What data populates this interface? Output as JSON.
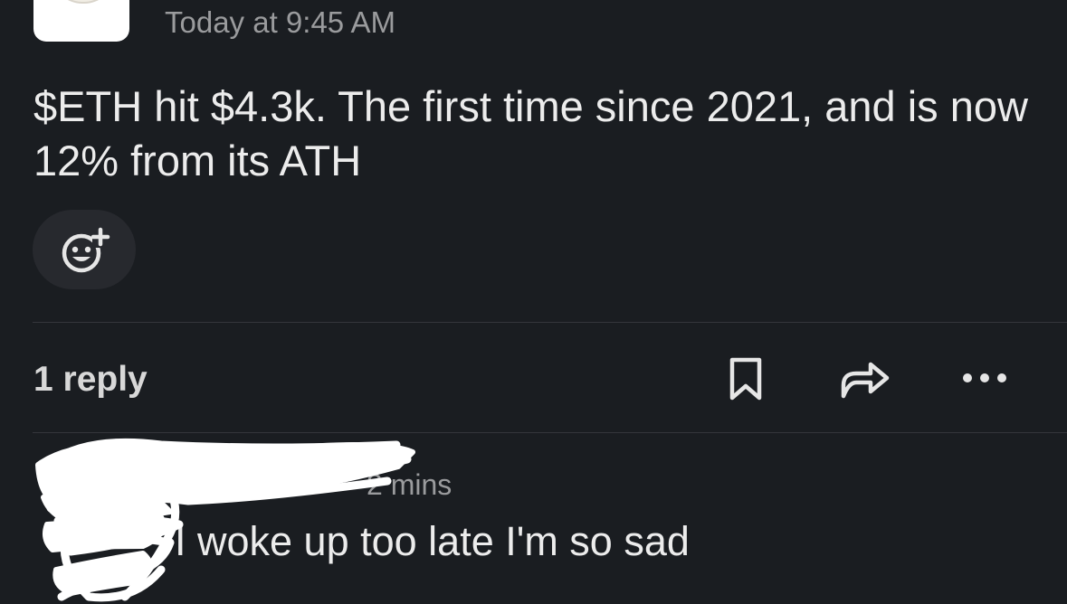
{
  "post": {
    "timestamp": "Today at 9:45 AM",
    "message": "$ETH hit $4.3k. The first time since 2021, and is now 12% from its ATH"
  },
  "thread": {
    "reply_count": "1 reply"
  },
  "reply": {
    "time_partial": "2 mins",
    "text": "I woke up too late I'm so sad"
  },
  "icons": {
    "reaction": "add-reaction-icon",
    "bookmark": "bookmark-icon",
    "share": "share-icon",
    "more": "more-options-icon"
  },
  "colors": {
    "background": "#1a1d21",
    "text_primary": "#ececec",
    "text_secondary": "#9a9b9d",
    "divider": "#34363b",
    "pill": "#27292e"
  }
}
